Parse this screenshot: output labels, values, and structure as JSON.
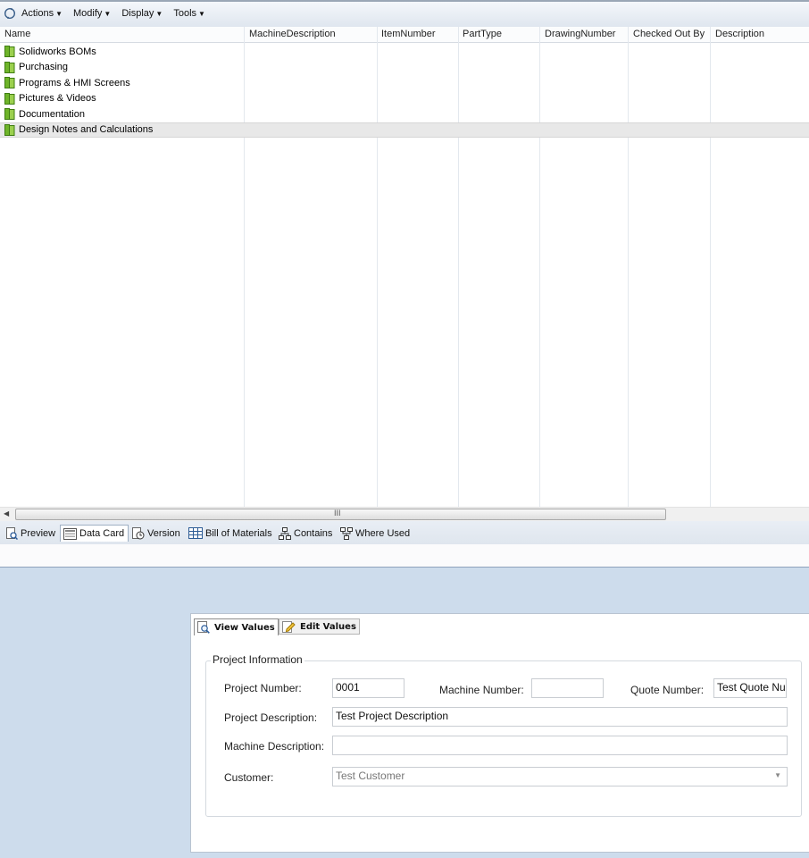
{
  "toolbar": {
    "menus": [
      {
        "label": "Actions"
      },
      {
        "label": "Modify"
      },
      {
        "label": "Display"
      },
      {
        "label": "Tools"
      }
    ]
  },
  "grid": {
    "columns": [
      "Name",
      "MachineDescription",
      "ItemNumber",
      "PartType",
      "DrawingNumber",
      "Checked Out By",
      "Description"
    ],
    "rows": [
      {
        "name": "Solidworks BOMs"
      },
      {
        "name": "Purchasing"
      },
      {
        "name": "Programs & HMI Screens"
      },
      {
        "name": "Pictures & Videos"
      },
      {
        "name": "Documentation"
      },
      {
        "name": "Design Notes and Calculations",
        "selected": true
      }
    ],
    "scroll_grip": "III"
  },
  "tabs": [
    {
      "label": "Preview",
      "icon": "preview-icon"
    },
    {
      "label": "Data Card",
      "icon": "data-card-icon",
      "active": true
    },
    {
      "label": "Version",
      "icon": "version-icon"
    },
    {
      "label": "Bill of Materials",
      "icon": "bom-icon"
    },
    {
      "label": "Contains",
      "icon": "contains-icon"
    },
    {
      "label": "Where Used",
      "icon": "where-used-icon"
    }
  ],
  "datacard": {
    "view_tab": "View Values",
    "edit_tab": "Edit Values",
    "group_title": "Project Information",
    "project_number_label": "Project Number:",
    "project_number_value": "0001",
    "machine_number_label": "Machine Number:",
    "machine_number_value": "",
    "quote_number_label": "Quote Number:",
    "quote_number_value": "Test Quote Nu",
    "project_description_label": "Project Description:",
    "project_description_value": "Test Project Description",
    "machine_description_label": "Machine Description:",
    "machine_description_value": "",
    "customer_label": "Customer:",
    "customer_value": "Test Customer"
  },
  "colors": {
    "folder": "#6fb52a",
    "panel_background": "#cddcec",
    "selected_row": "#e8e8e8"
  }
}
